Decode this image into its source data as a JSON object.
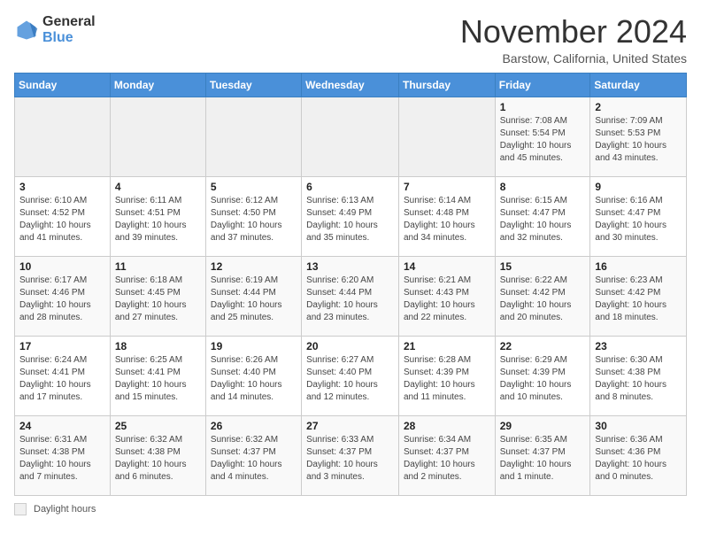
{
  "logo": {
    "general": "General",
    "blue": "Blue"
  },
  "header": {
    "month": "November 2024",
    "location": "Barstow, California, United States"
  },
  "days_of_week": [
    "Sunday",
    "Monday",
    "Tuesday",
    "Wednesday",
    "Thursday",
    "Friday",
    "Saturday"
  ],
  "weeks": [
    [
      {
        "day": "",
        "info": ""
      },
      {
        "day": "",
        "info": ""
      },
      {
        "day": "",
        "info": ""
      },
      {
        "day": "",
        "info": ""
      },
      {
        "day": "",
        "info": ""
      },
      {
        "day": "1",
        "info": "Sunrise: 7:08 AM\nSunset: 5:54 PM\nDaylight: 10 hours and 45 minutes."
      },
      {
        "day": "2",
        "info": "Sunrise: 7:09 AM\nSunset: 5:53 PM\nDaylight: 10 hours and 43 minutes."
      }
    ],
    [
      {
        "day": "3",
        "info": "Sunrise: 6:10 AM\nSunset: 4:52 PM\nDaylight: 10 hours and 41 minutes."
      },
      {
        "day": "4",
        "info": "Sunrise: 6:11 AM\nSunset: 4:51 PM\nDaylight: 10 hours and 39 minutes."
      },
      {
        "day": "5",
        "info": "Sunrise: 6:12 AM\nSunset: 4:50 PM\nDaylight: 10 hours and 37 minutes."
      },
      {
        "day": "6",
        "info": "Sunrise: 6:13 AM\nSunset: 4:49 PM\nDaylight: 10 hours and 35 minutes."
      },
      {
        "day": "7",
        "info": "Sunrise: 6:14 AM\nSunset: 4:48 PM\nDaylight: 10 hours and 34 minutes."
      },
      {
        "day": "8",
        "info": "Sunrise: 6:15 AM\nSunset: 4:47 PM\nDaylight: 10 hours and 32 minutes."
      },
      {
        "day": "9",
        "info": "Sunrise: 6:16 AM\nSunset: 4:47 PM\nDaylight: 10 hours and 30 minutes."
      }
    ],
    [
      {
        "day": "10",
        "info": "Sunrise: 6:17 AM\nSunset: 4:46 PM\nDaylight: 10 hours and 28 minutes."
      },
      {
        "day": "11",
        "info": "Sunrise: 6:18 AM\nSunset: 4:45 PM\nDaylight: 10 hours and 27 minutes."
      },
      {
        "day": "12",
        "info": "Sunrise: 6:19 AM\nSunset: 4:44 PM\nDaylight: 10 hours and 25 minutes."
      },
      {
        "day": "13",
        "info": "Sunrise: 6:20 AM\nSunset: 4:44 PM\nDaylight: 10 hours and 23 minutes."
      },
      {
        "day": "14",
        "info": "Sunrise: 6:21 AM\nSunset: 4:43 PM\nDaylight: 10 hours and 22 minutes."
      },
      {
        "day": "15",
        "info": "Sunrise: 6:22 AM\nSunset: 4:42 PM\nDaylight: 10 hours and 20 minutes."
      },
      {
        "day": "16",
        "info": "Sunrise: 6:23 AM\nSunset: 4:42 PM\nDaylight: 10 hours and 18 minutes."
      }
    ],
    [
      {
        "day": "17",
        "info": "Sunrise: 6:24 AM\nSunset: 4:41 PM\nDaylight: 10 hours and 17 minutes."
      },
      {
        "day": "18",
        "info": "Sunrise: 6:25 AM\nSunset: 4:41 PM\nDaylight: 10 hours and 15 minutes."
      },
      {
        "day": "19",
        "info": "Sunrise: 6:26 AM\nSunset: 4:40 PM\nDaylight: 10 hours and 14 minutes."
      },
      {
        "day": "20",
        "info": "Sunrise: 6:27 AM\nSunset: 4:40 PM\nDaylight: 10 hours and 12 minutes."
      },
      {
        "day": "21",
        "info": "Sunrise: 6:28 AM\nSunset: 4:39 PM\nDaylight: 10 hours and 11 minutes."
      },
      {
        "day": "22",
        "info": "Sunrise: 6:29 AM\nSunset: 4:39 PM\nDaylight: 10 hours and 10 minutes."
      },
      {
        "day": "23",
        "info": "Sunrise: 6:30 AM\nSunset: 4:38 PM\nDaylight: 10 hours and 8 minutes."
      }
    ],
    [
      {
        "day": "24",
        "info": "Sunrise: 6:31 AM\nSunset: 4:38 PM\nDaylight: 10 hours and 7 minutes."
      },
      {
        "day": "25",
        "info": "Sunrise: 6:32 AM\nSunset: 4:38 PM\nDaylight: 10 hours and 6 minutes."
      },
      {
        "day": "26",
        "info": "Sunrise: 6:32 AM\nSunset: 4:37 PM\nDaylight: 10 hours and 4 minutes."
      },
      {
        "day": "27",
        "info": "Sunrise: 6:33 AM\nSunset: 4:37 PM\nDaylight: 10 hours and 3 minutes."
      },
      {
        "day": "28",
        "info": "Sunrise: 6:34 AM\nSunset: 4:37 PM\nDaylight: 10 hours and 2 minutes."
      },
      {
        "day": "29",
        "info": "Sunrise: 6:35 AM\nSunset: 4:37 PM\nDaylight: 10 hours and 1 minute."
      },
      {
        "day": "30",
        "info": "Sunrise: 6:36 AM\nSunset: 4:36 PM\nDaylight: 10 hours and 0 minutes."
      }
    ]
  ],
  "legend": {
    "box_label": "Daylight hours"
  }
}
